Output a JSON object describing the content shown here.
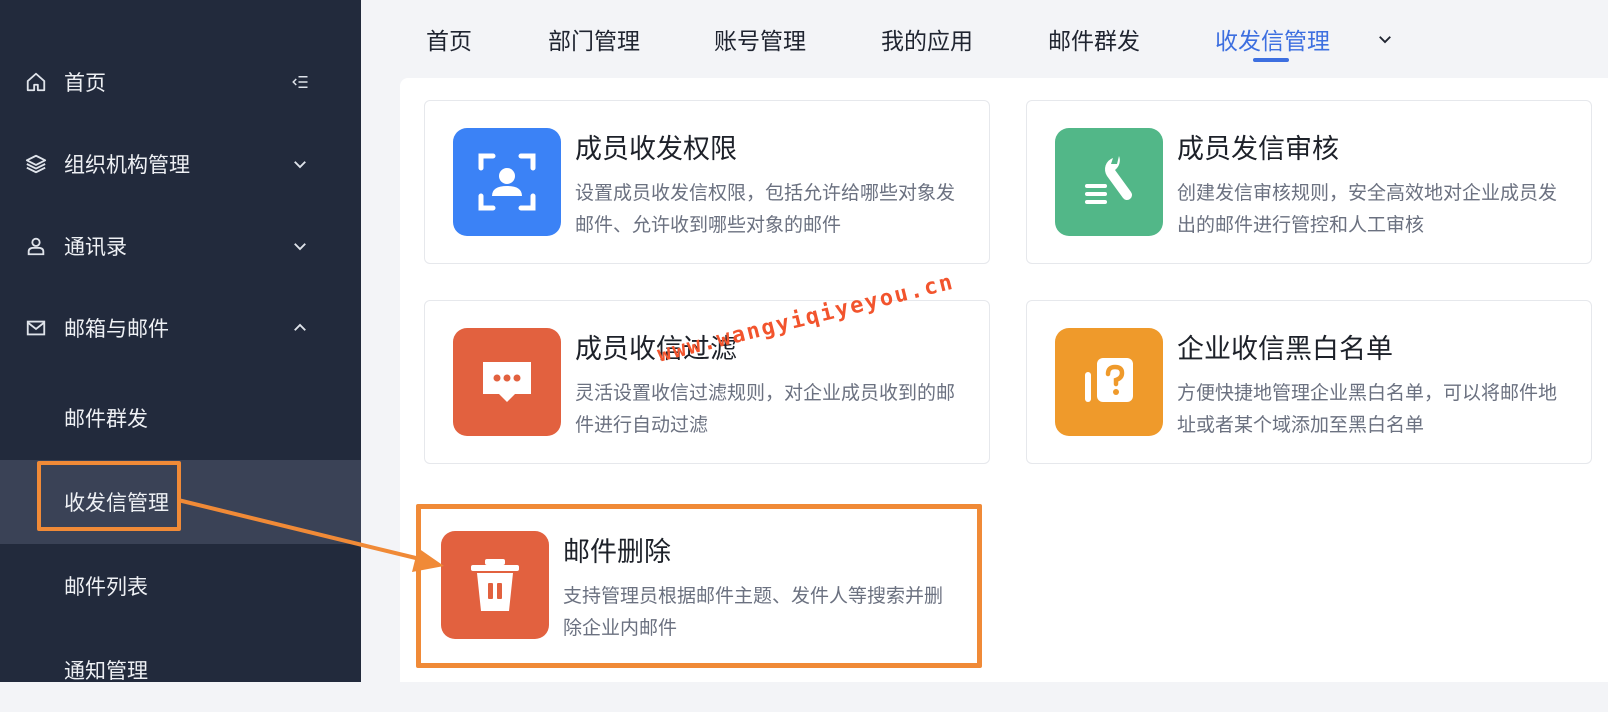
{
  "sidebar": {
    "items": [
      {
        "label": "首页",
        "icon": "home-icon",
        "control": "menu-fold-icon"
      },
      {
        "label": "组织机构管理",
        "icon": "layers-icon",
        "control": "chevron-down-icon"
      },
      {
        "label": "通讯录",
        "icon": "user-icon",
        "control": "chevron-down-icon"
      },
      {
        "label": "邮箱与邮件",
        "icon": "mail-icon",
        "control": "chevron-up-icon"
      }
    ],
    "subitems": [
      {
        "label": "邮件群发"
      },
      {
        "label": "收发信管理",
        "active": true
      },
      {
        "label": "邮件列表"
      },
      {
        "label": "通知管理"
      }
    ]
  },
  "tabs": {
    "items": [
      "首页",
      "部门管理",
      "账号管理",
      "我的应用",
      "邮件群发",
      "收发信管理"
    ],
    "active_index": 5,
    "more_icon": "chevron-down-icon"
  },
  "cards": [
    {
      "title": "成员收发权限",
      "desc": "设置成员收发信权限，包括允许给哪些对象发邮件、允许收到哪些对象的邮件",
      "icon": "face-scan-icon",
      "color": "#3b82f6"
    },
    {
      "title": "成员发信审核",
      "desc": "创建发信审核规则，安全高效地对企业成员发出的邮件进行管控和人工审核",
      "icon": "wrench-icon",
      "color": "#52b788"
    },
    {
      "title": "成员收信过滤",
      "desc": "灵活设置收信过滤规则，对企业成员收到的邮件进行自动过滤",
      "icon": "chat-bubble-icon",
      "color": "#e2613f"
    },
    {
      "title": "企业收信黑白名单",
      "desc": "方便快捷地管理企业黑白名单，可以将邮件地址或者某个域添加至黑白名单",
      "icon": "question-doc-icon",
      "color": "#ef9a2b"
    },
    {
      "title": "邮件删除",
      "desc": "支持管理员根据邮件主题、发件人等搜索并删除企业内邮件",
      "icon": "trash-icon",
      "color": "#e2613f"
    }
  ],
  "watermark": "www.wangyiqiyeyou.cn",
  "annotation_color": "#f08a37"
}
